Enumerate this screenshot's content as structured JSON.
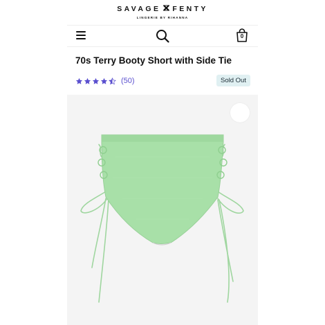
{
  "header": {
    "brand_left": "SAVAGE",
    "brand_right": "FENTY",
    "tagline": "LINGERIE BY RIHANNA",
    "cart_count": "0"
  },
  "icons": {
    "menu": "hamburger-menu-icon",
    "search": "search-icon",
    "cart": "shopping-bag-icon",
    "favorite": "heart-icon"
  },
  "product": {
    "title": "70s Terry Booty Short with Side Tie",
    "rating": 4.5,
    "rating_max": 5,
    "review_count": "(50)",
    "status": "Sold Out"
  },
  "colors": {
    "star": "#5a4fcf",
    "badge_bg": "#e0f0f2",
    "product": "#a8e0a8"
  }
}
